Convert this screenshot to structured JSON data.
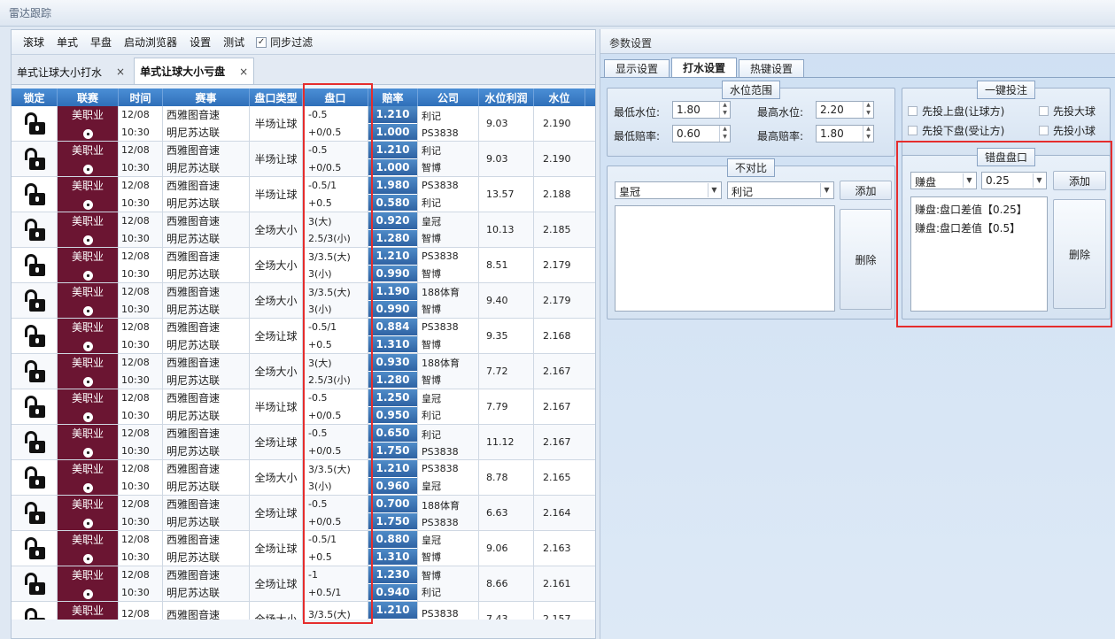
{
  "app_title": "雷达跟踪",
  "menu": {
    "items": [
      "滚球",
      "单式",
      "早盘",
      "启动浏览器",
      "设置",
      "测试"
    ],
    "sync_filter_label": "同步过滤",
    "sync_filter_checked": "✓"
  },
  "doc_tabs": [
    {
      "label": "单式让球大小打水",
      "close": "×"
    },
    {
      "label": "单式让球大小亏盘",
      "close": "×"
    }
  ],
  "grid": {
    "headers": [
      "锁定",
      "联赛",
      "时间",
      "赛事",
      "盘口类型",
      "盘口",
      "赔率",
      "公司",
      "水位利润",
      "水位"
    ],
    "rows": [
      {
        "league": "美职业",
        "date": "12/08",
        "time": "10:30",
        "home": "西雅图音速",
        "away": "明尼苏达联",
        "type": "半场让球",
        "pk1": "-0.5",
        "pk2": "+0/0.5",
        "o1": "1.210",
        "o2": "1.000",
        "co1": "利记",
        "co2": "PS3838",
        "profit": "9.03",
        "water": "2.190"
      },
      {
        "league": "美职业",
        "date": "12/08",
        "time": "10:30",
        "home": "西雅图音速",
        "away": "明尼苏达联",
        "type": "半场让球",
        "pk1": "-0.5",
        "pk2": "+0/0.5",
        "o1": "1.210",
        "o2": "1.000",
        "co1": "利记",
        "co2": "智博",
        "profit": "9.03",
        "water": "2.190"
      },
      {
        "league": "美职业",
        "date": "12/08",
        "time": "10:30",
        "home": "西雅图音速",
        "away": "明尼苏达联",
        "type": "半场让球",
        "pk1": "-0.5/1",
        "pk2": "+0.5",
        "o1": "1.980",
        "o2": "0.580",
        "co1": "PS3838",
        "co2": "利记",
        "profit": "13.57",
        "water": "2.188"
      },
      {
        "league": "美职业",
        "date": "12/08",
        "time": "10:30",
        "home": "西雅图音速",
        "away": "明尼苏达联",
        "type": "全场大小",
        "pk1": "3(大)",
        "pk2": "2.5/3(小)",
        "o1": "0.920",
        "o2": "1.280",
        "co1": "皇冠",
        "co2": "智博",
        "profit": "10.13",
        "water": "2.185"
      },
      {
        "league": "美职业",
        "date": "12/08",
        "time": "10:30",
        "home": "西雅图音速",
        "away": "明尼苏达联",
        "type": "全场大小",
        "pk1": "3/3.5(大)",
        "pk2": "3(小)",
        "o1": "1.210",
        "o2": "0.990",
        "co1": "PS3838",
        "co2": "智博",
        "profit": "8.51",
        "water": "2.179"
      },
      {
        "league": "美职业",
        "date": "12/08",
        "time": "10:30",
        "home": "西雅图音速",
        "away": "明尼苏达联",
        "type": "全场大小",
        "pk1": "3/3.5(大)",
        "pk2": "3(小)",
        "o1": "1.190",
        "o2": "0.990",
        "co1": "188体育",
        "co2": "智博",
        "profit": "9.40",
        "water": "2.179"
      },
      {
        "league": "美职业",
        "date": "12/08",
        "time": "10:30",
        "home": "西雅图音速",
        "away": "明尼苏达联",
        "type": "全场让球",
        "pk1": "-0.5/1",
        "pk2": "+0.5",
        "o1": "0.884",
        "o2": "1.310",
        "co1": "PS3838",
        "co2": "智博",
        "profit": "9.35",
        "water": "2.168"
      },
      {
        "league": "美职业",
        "date": "12/08",
        "time": "10:30",
        "home": "西雅图音速",
        "away": "明尼苏达联",
        "type": "全场大小",
        "pk1": "3(大)",
        "pk2": "2.5/3(小)",
        "o1": "0.930",
        "o2": "1.280",
        "co1": "188体育",
        "co2": "智博",
        "profit": "7.72",
        "water": "2.167"
      },
      {
        "league": "美职业",
        "date": "12/08",
        "time": "10:30",
        "home": "西雅图音速",
        "away": "明尼苏达联",
        "type": "半场让球",
        "pk1": "-0.5",
        "pk2": "+0/0.5",
        "o1": "1.250",
        "o2": "0.950",
        "co1": "皇冠",
        "co2": "利记",
        "profit": "7.79",
        "water": "2.167"
      },
      {
        "league": "美职业",
        "date": "12/08",
        "time": "10:30",
        "home": "西雅图音速",
        "away": "明尼苏达联",
        "type": "全场让球",
        "pk1": "-0.5",
        "pk2": "+0/0.5",
        "o1": "0.650",
        "o2": "1.750",
        "co1": "利记",
        "co2": "PS3838",
        "profit": "11.12",
        "water": "2.167"
      },
      {
        "league": "美职业",
        "date": "12/08",
        "time": "10:30",
        "home": "西雅图音速",
        "away": "明尼苏达联",
        "type": "全场大小",
        "pk1": "3/3.5(大)",
        "pk2": "3(小)",
        "o1": "1.210",
        "o2": "0.960",
        "co1": "PS3838",
        "co2": "皇冠",
        "profit": "8.78",
        "water": "2.165"
      },
      {
        "league": "美职业",
        "date": "12/08",
        "time": "10:30",
        "home": "西雅图音速",
        "away": "明尼苏达联",
        "type": "全场让球",
        "pk1": "-0.5",
        "pk2": "+0/0.5",
        "o1": "0.700",
        "o2": "1.750",
        "co1": "188体育",
        "co2": "PS3838",
        "profit": "6.63",
        "water": "2.164"
      },
      {
        "league": "美职业",
        "date": "12/08",
        "time": "10:30",
        "home": "西雅图音速",
        "away": "明尼苏达联",
        "type": "全场让球",
        "pk1": "-0.5/1",
        "pk2": "+0.5",
        "o1": "0.880",
        "o2": "1.310",
        "co1": "皇冠",
        "co2": "智博",
        "profit": "9.06",
        "water": "2.163"
      },
      {
        "league": "美职业",
        "date": "12/08",
        "time": "10:30",
        "home": "西雅图音速",
        "away": "明尼苏达联",
        "type": "全场让球",
        "pk1": "-1",
        "pk2": "+0.5/1",
        "o1": "1.230",
        "o2": "0.940",
        "co1": "智博",
        "co2": "利记",
        "profit": "8.66",
        "water": "2.161"
      },
      {
        "league": "美职业",
        "date": "12/08",
        "time": "",
        "home": "西雅图音速",
        "away": "",
        "type": "全场大小",
        "pk1": "3/3.5(大)",
        "pk2": "",
        "o1": "1.210",
        "o2": "",
        "co1": "PS3838",
        "co2": "",
        "profit": "7.43",
        "water": "2.157"
      }
    ]
  },
  "settings": {
    "panel_title": "参数设置",
    "tabs": [
      "显示设置",
      "打水设置",
      "热键设置"
    ],
    "water_range": {
      "title": "水位范围",
      "min_water_label": "最低水位:",
      "min_water": "1.80",
      "max_water_label": "最高水位:",
      "max_water": "2.20",
      "min_odds_label": "最低赔率:",
      "min_odds": "0.60",
      "max_odds_label": "最高赔率:",
      "max_odds": "1.80"
    },
    "one_click": {
      "title": "一键投注",
      "opt1": "先投上盘(让球方)",
      "opt2": "先投大球",
      "opt3": "先投下盘(受让方)",
      "opt4": "先投小球"
    },
    "no_compare": {
      "title": "不对比",
      "combo1": "皇冠",
      "combo2": "利记",
      "add_label": "添加",
      "delete_label": "删除"
    },
    "wrong_pk": {
      "title": "错盘盘口",
      "combo1": "赚盘",
      "combo2": "0.25",
      "add_label": "添加",
      "delete_label": "删除",
      "list": [
        "赚盘:盘口差值【0.25】",
        "赚盘:盘口差值【0.5】"
      ]
    }
  },
  "colors": {
    "highlight": "#e52d2d",
    "league_bg": "#6b1532",
    "odds_bg": "#2f63a3",
    "header_bg": "#2f6fb9"
  }
}
